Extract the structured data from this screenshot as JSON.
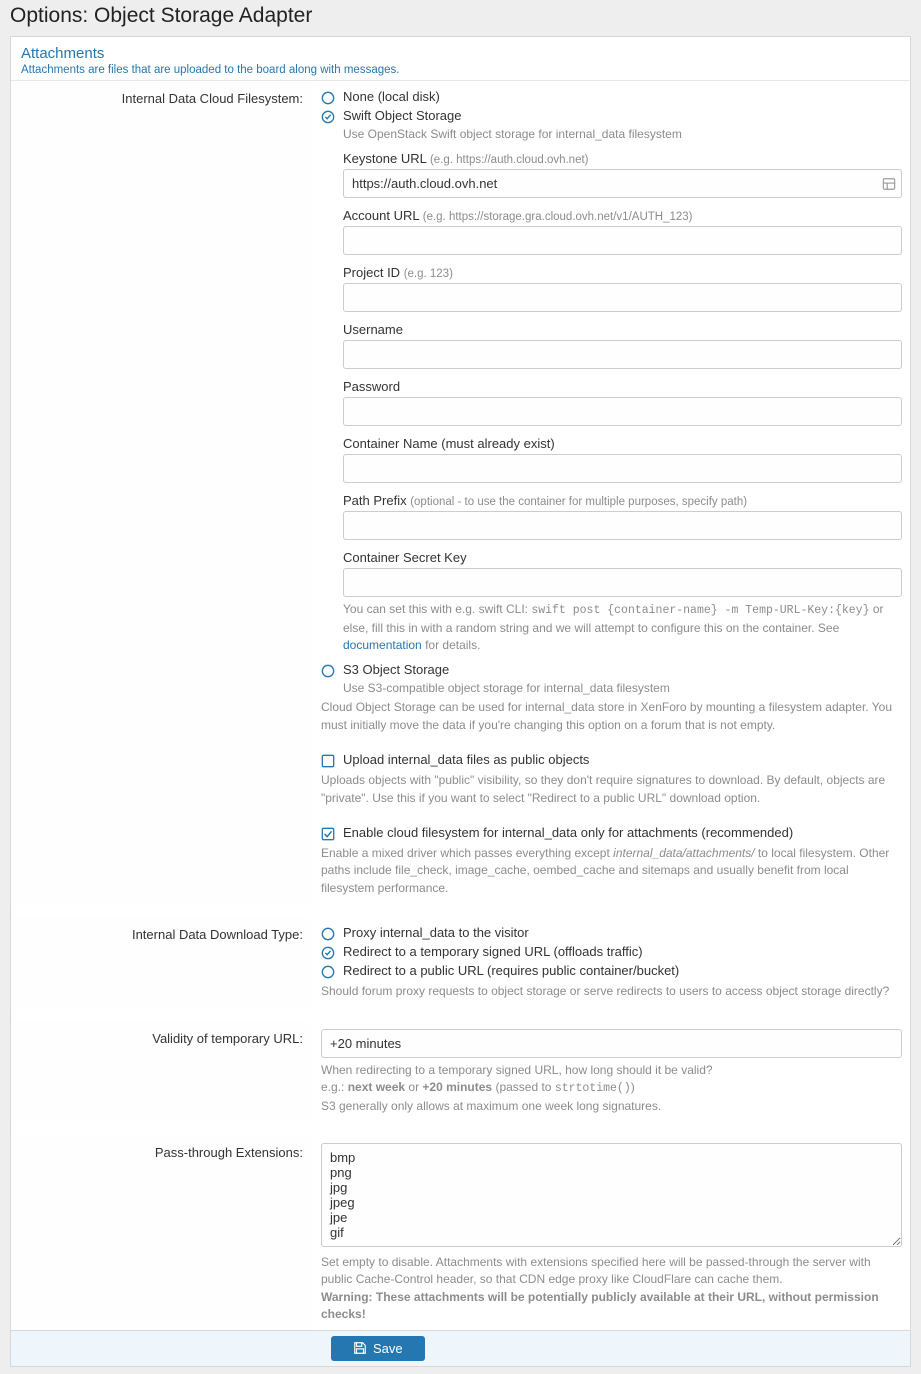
{
  "pageTitle": "Options: Object Storage Adapter",
  "panel": {
    "headerLink": "Attachments",
    "headerSub": "Attachments are files that are uploaded to the board along with messages."
  },
  "fs": {
    "label": "Internal Data Cloud Filesystem:",
    "none": {
      "label": "None (local disk)"
    },
    "swift": {
      "label": "Swift Object Storage",
      "hint": "Use OpenStack Swift object storage for internal_data filesystem",
      "keystone": {
        "label": "Keystone URL ",
        "hint": "(e.g. https://auth.cloud.ovh.net)",
        "value": "https://auth.cloud.ovh.net"
      },
      "accounturl": {
        "label": "Account URL ",
        "hint": "(e.g. https://storage.gra.cloud.ovh.net/v1/AUTH_123)",
        "value": ""
      },
      "projectid": {
        "label": "Project ID ",
        "hint": "(e.g. 123)",
        "value": ""
      },
      "username": {
        "label": "Username",
        "value": ""
      },
      "password": {
        "label": "Password",
        "value": ""
      },
      "container": {
        "label": "Container Name (must already exist)",
        "value": ""
      },
      "prefix": {
        "label": "Path Prefix ",
        "hint": "(optional - to use the container for multiple purposes, specify path)",
        "value": ""
      },
      "secret": {
        "label": "Container Secret Key",
        "value": "",
        "explain_pre": "You can set this with e.g. swift CLI: ",
        "explain_code": "swift post {container-name} -m Temp-URL-Key:{key}",
        "explain_mid": " or else, fill this in with a random string and we will attempt to configure this on the container. See ",
        "explain_link": "documentation",
        "explain_post": " for details."
      }
    },
    "s3": {
      "label": "S3 Object Storage",
      "hint": "Use S3-compatible object storage for internal_data filesystem"
    },
    "explain": "Cloud Object Storage can be used for internal_data store in XenForo by mounting a filesystem adapter. You must initially move the data if you're changing this option on a forum that is not empty."
  },
  "publicObjects": {
    "label": "Upload internal_data files as public objects",
    "explain": "Uploads objects with \"public\" visibility, so they don't require signatures to download. By default, objects are \"private\". Use this if you want to select \"Redirect to a public URL\" download option."
  },
  "attachOnly": {
    "label": "Enable cloud filesystem for internal_data only for attachments (recommended)",
    "explain_pre": "Enable a mixed driver which passes everything except ",
    "explain_em": "internal_data/attachments/",
    "explain_post": " to local filesystem. Other paths include file_check, image_cache, oembed_cache and sitemaps and usually benefit from local filesystem performance."
  },
  "downloadType": {
    "label": "Internal Data Download Type:",
    "opt1": "Proxy internal_data to the visitor",
    "opt2": "Redirect to a temporary signed URL (offloads traffic)",
    "opt3": "Redirect to a public URL (requires public container/bucket)",
    "explain": "Should forum proxy requests to object storage or serve redirects to users to access object storage directly?"
  },
  "validity": {
    "label": "Validity of temporary URL:",
    "value": "+20 minutes",
    "explain1": "When redirecting to a temporary signed URL, how long should it be valid?",
    "explain2_pre": "e.g.: ",
    "explain2_b1": "next week",
    "explain2_or": " or ",
    "explain2_b2": "+20 minutes",
    "explain2_mid": " (passed to ",
    "explain2_code": "strtotime()",
    "explain2_post": ")",
    "explain3": "S3 generally only allows at maximum one week long signatures."
  },
  "passthrough": {
    "label": "Pass-through Extensions:",
    "value": "bmp\npng\njpg\njpeg\njpe\ngif",
    "explain": "Set empty to disable. Attachments with extensions specified here will be passed-through the server with public Cache-Control header, so that CDN edge proxy like CloudFlare can cache them.",
    "warning": "Warning: These attachments will be potentially publicly available at their URL, without permission checks!"
  },
  "save": "Save"
}
